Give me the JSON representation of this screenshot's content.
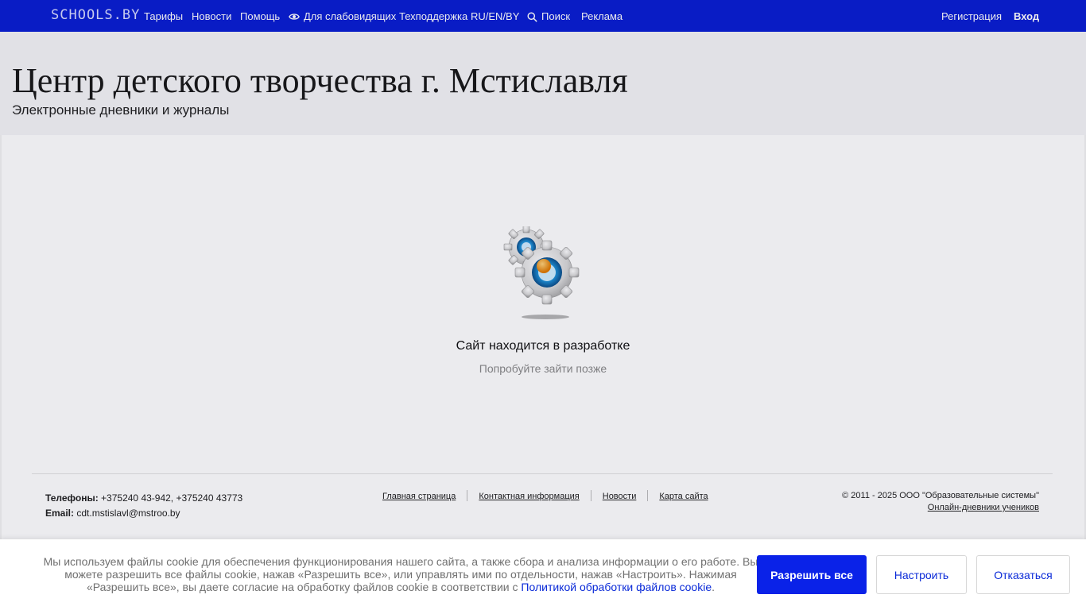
{
  "nav": {
    "logo": "SCHOOLS.BY",
    "items": [
      {
        "label": "Тарифы"
      },
      {
        "label": "Новости"
      },
      {
        "label": "Помощь"
      },
      {
        "label": "Для слабовидящих"
      },
      {
        "label": "Техподдержка"
      },
      {
        "label": "RU/EN/BY"
      },
      {
        "label": "Поиск"
      },
      {
        "label": "Реклама"
      }
    ],
    "register": "Регистрация",
    "login": "Вход",
    "icons": {
      "visually_impaired": "eye-icon",
      "search": "search-icon"
    }
  },
  "header": {
    "title": "Центр детского творчества г. Мстиславля",
    "subtitle": "Электронные дневники и журналы"
  },
  "main": {
    "status_title": "Сайт находится в разработке",
    "status_subtitle": "Попробуйте зайти позже",
    "illustration": "gears-icon"
  },
  "footer": {
    "phones_label": "Телефоны:",
    "phones_value": " +375240 43-942, +375240 43773",
    "email_label": "Email:",
    "email_value": " cdt.mstislavl@mstroo.by",
    "links": [
      {
        "label": "Главная страница"
      },
      {
        "label": "Контактная информация"
      },
      {
        "label": "Новости"
      },
      {
        "label": "Карта сайта"
      }
    ],
    "copyright": "© 2011 - 2025 ООО \"Образовательные системы\"",
    "diaries_link": "Онлайн-дневники учеников"
  },
  "cookie": {
    "text": "Мы используем файлы cookie для обеспечения функционирования нашего сайта, а также сбора и анализа информации о его работе. Вы можете разрешить все файлы cookie, нажав «Разрешить все», или управлять ими по отдельности, нажав «Настроить». Нажимая «Разрешить все», вы даете согласие на обработку файлов cookie в соответствии с ",
    "policy_link": "Политикой обработки файлов cookie",
    "text_end": ".",
    "accept": "Разрешить все",
    "settings": "Настроить",
    "decline": "Отказаться"
  },
  "colors": {
    "nav_bg": "#0a1fd3",
    "accent_button": "#0a22e8",
    "link": "#0a2ad8"
  }
}
